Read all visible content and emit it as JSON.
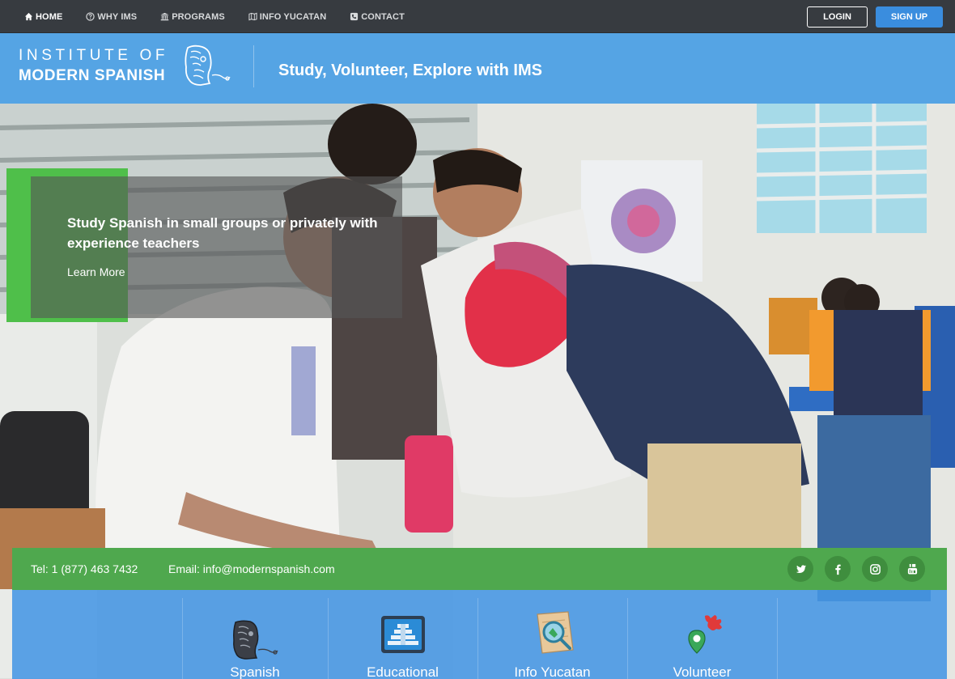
{
  "nav": {
    "links": [
      {
        "label": "HOME",
        "icon": "home-icon",
        "active": true
      },
      {
        "label": "WHY IMS",
        "icon": "question-circle-icon",
        "active": false
      },
      {
        "label": "PROGRAMS",
        "icon": "institution-icon",
        "active": false
      },
      {
        "label": "INFO YUCATAN",
        "icon": "map-icon",
        "active": false
      },
      {
        "label": "CONTACT",
        "icon": "phone-square-icon",
        "active": false
      }
    ],
    "login_label": "LOGIN",
    "signup_label": "SIGN UP"
  },
  "header": {
    "logo_line1": "INSTITUTE OF",
    "logo_line2": "MODERN SPANISH",
    "tagline": "Study, Volunteer, Explore with IMS"
  },
  "hero": {
    "caption": "Study Spanish in small groups or privately with experience teachers",
    "learn_more": "Learn More"
  },
  "contact": {
    "tel": "Tel: 1 (877) 463 7432",
    "email": "Email: info@modernspanish.com",
    "social": [
      "twitter-icon",
      "facebook-icon",
      "instagram-icon",
      "youtube-icon"
    ]
  },
  "programs": [
    {
      "label": "Spanish",
      "icon": "mayan-head-icon"
    },
    {
      "label": "Educational",
      "icon": "pyramid-icon"
    },
    {
      "label": "Info Yucatan",
      "icon": "map-magnifier-icon"
    },
    {
      "label": "Volunteer",
      "icon": "volunteer-pin-icon"
    }
  ],
  "colors": {
    "nav_bg": "#373b40",
    "header_blue": "#55a4e4",
    "signup_blue": "#3a8dde",
    "contact_green": "#4fa84e",
    "programs_blue": "#4696e4"
  }
}
